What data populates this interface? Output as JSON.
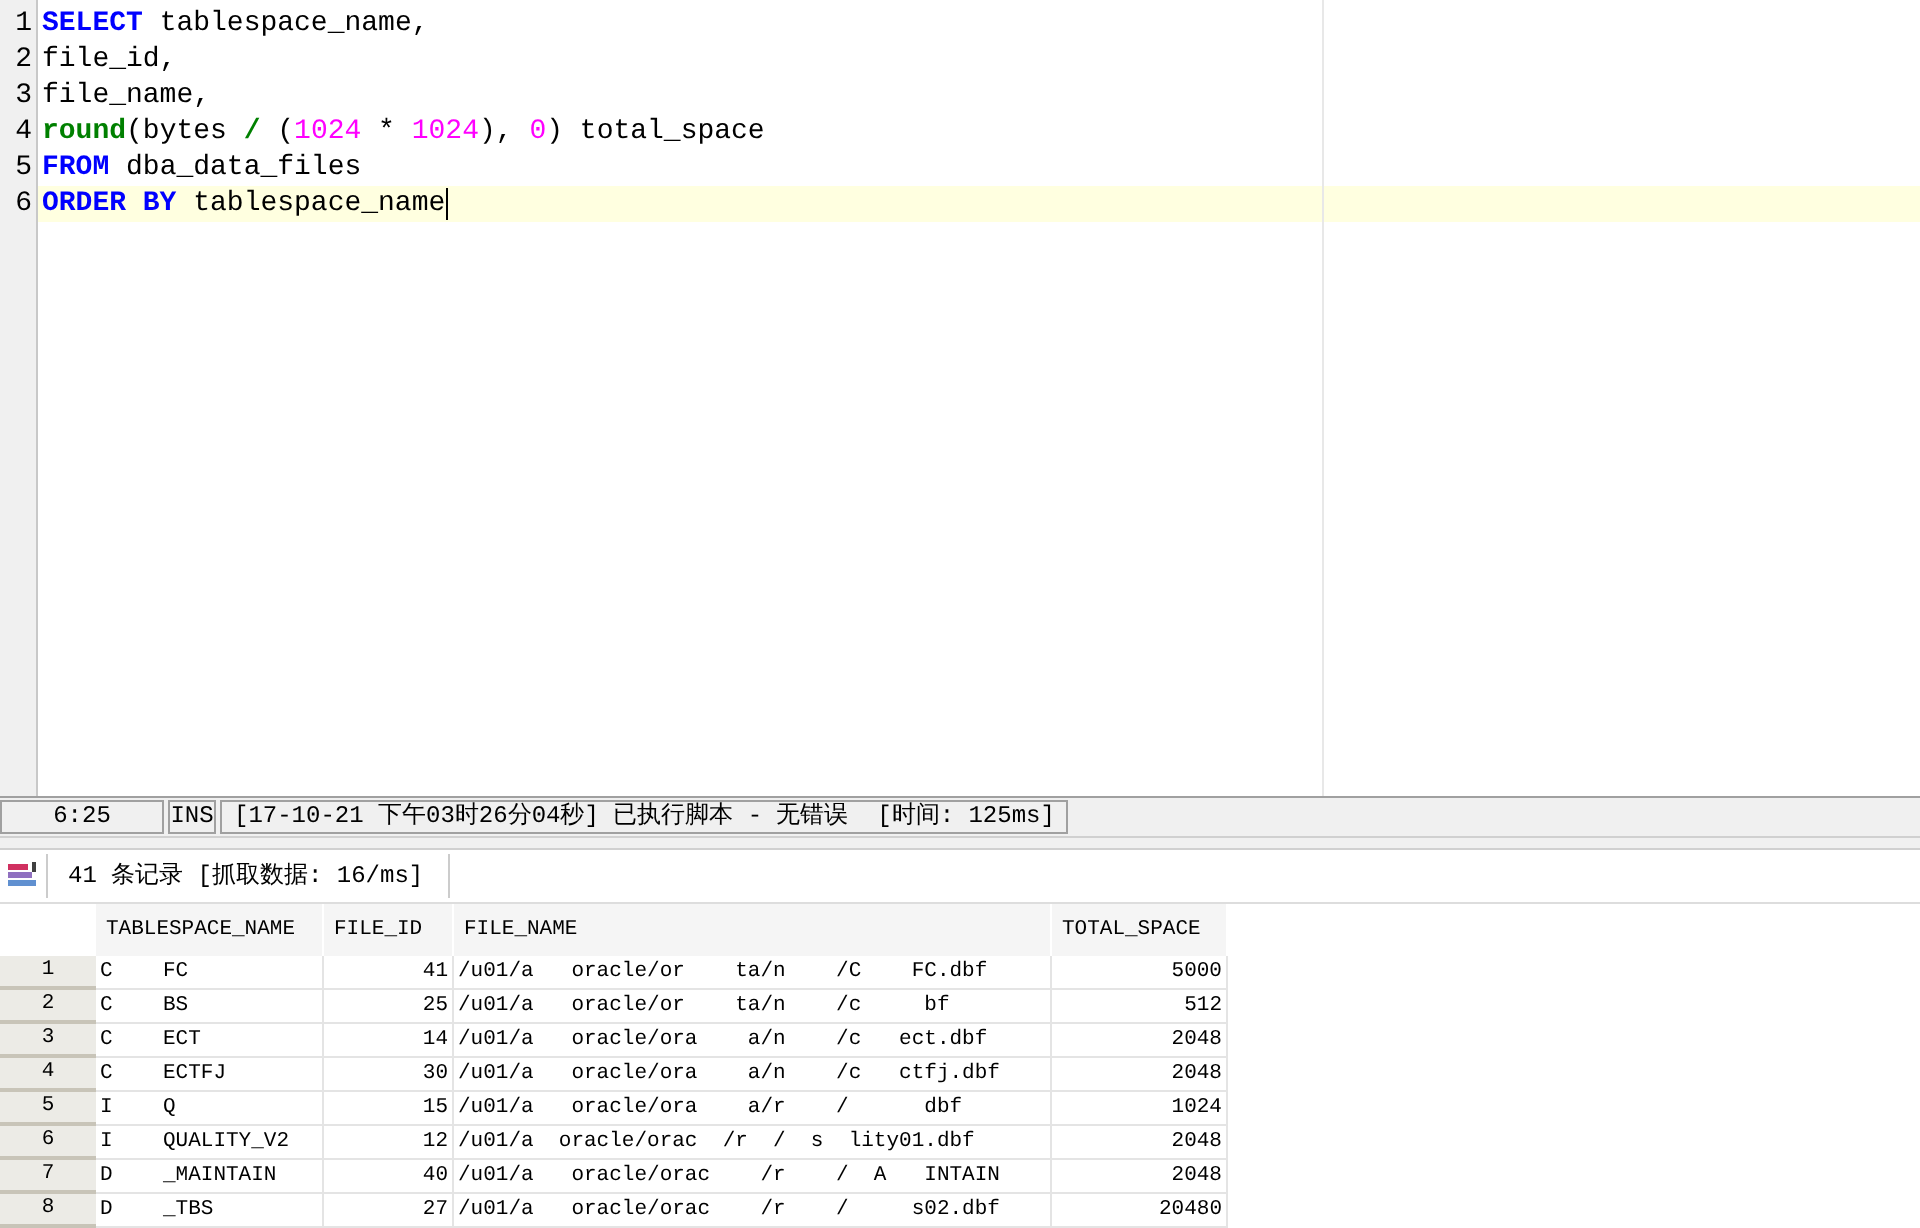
{
  "editor": {
    "lines": [
      {
        "number": "1",
        "current": false,
        "tokens": [
          {
            "kind": "keyword",
            "text": "SELECT"
          },
          {
            "kind": "text",
            "text": " tablespace_name,"
          }
        ]
      },
      {
        "number": "2",
        "current": false,
        "tokens": [
          {
            "kind": "text",
            "text": "file_id,"
          }
        ]
      },
      {
        "number": "3",
        "current": false,
        "tokens": [
          {
            "kind": "text",
            "text": "file_name,"
          }
        ]
      },
      {
        "number": "4",
        "current": false,
        "tokens": [
          {
            "kind": "function",
            "text": "round"
          },
          {
            "kind": "text",
            "text": "(bytes "
          },
          {
            "kind": "operator",
            "text": "/"
          },
          {
            "kind": "text",
            "text": " ("
          },
          {
            "kind": "number",
            "text": "1024"
          },
          {
            "kind": "text",
            "text": " * "
          },
          {
            "kind": "number",
            "text": "1024"
          },
          {
            "kind": "text",
            "text": "), "
          },
          {
            "kind": "number",
            "text": "0"
          },
          {
            "kind": "text",
            "text": ") total_space"
          }
        ]
      },
      {
        "number": "5",
        "current": false,
        "tokens": [
          {
            "kind": "keyword",
            "text": "FROM"
          },
          {
            "kind": "text",
            "text": " dba_data_files"
          }
        ]
      },
      {
        "number": "6",
        "current": true,
        "tokens": [
          {
            "kind": "keyword",
            "text": "ORDER BY"
          },
          {
            "kind": "text",
            "text": " tablespace_name"
          }
        ]
      }
    ]
  },
  "status_bar": {
    "position": "6:25",
    "mode": "INS",
    "message": "[17-10-21 下午03时26分04秒] 已执行脚本 - 无错误  [时间: 125ms]"
  },
  "results": {
    "summary": "41 条记录 [抓取数据: 16/ms]",
    "columns": [
      "TABLESPACE_NAME",
      "FILE_ID",
      "FILE_NAME",
      "TOTAL_SPACE"
    ],
    "rows": [
      {
        "number": "1",
        "cells": [
          "C    FC",
          "41",
          "/u01/a   oracle/or    ta/n    /C    FC.dbf",
          "5000"
        ]
      },
      {
        "number": "2",
        "cells": [
          "C    BS",
          "25",
          "/u01/a   oracle/or    ta/n    /c     bf",
          "512"
        ]
      },
      {
        "number": "3",
        "cells": [
          "C    ECT",
          "14",
          "/u01/a   oracle/ora    a/n    /c   ect.dbf",
          "2048"
        ]
      },
      {
        "number": "4",
        "cells": [
          "C    ECTFJ",
          "30",
          "/u01/a   oracle/ora    a/n    /c   ctfj.dbf",
          "2048"
        ]
      },
      {
        "number": "5",
        "cells": [
          "I    Q",
          "15",
          "/u01/a   oracle/ora    a/r    /      dbf",
          "1024"
        ]
      },
      {
        "number": "6",
        "cells": [
          "I    QUALITY_V2",
          "12",
          "/u01/a  oracle/orac  /r  /  s  lity01.dbf",
          "2048"
        ]
      },
      {
        "number": "7",
        "cells": [
          "D    _MAINTAIN",
          "40",
          "/u01/a   oracle/orac    /r    /  A   INTAIN",
          "2048"
        ]
      },
      {
        "number": "8",
        "cells": [
          "D    _TBS",
          "27",
          "/u01/a   oracle/orac    /r    /     s02.dbf",
          "20480"
        ]
      }
    ]
  }
}
